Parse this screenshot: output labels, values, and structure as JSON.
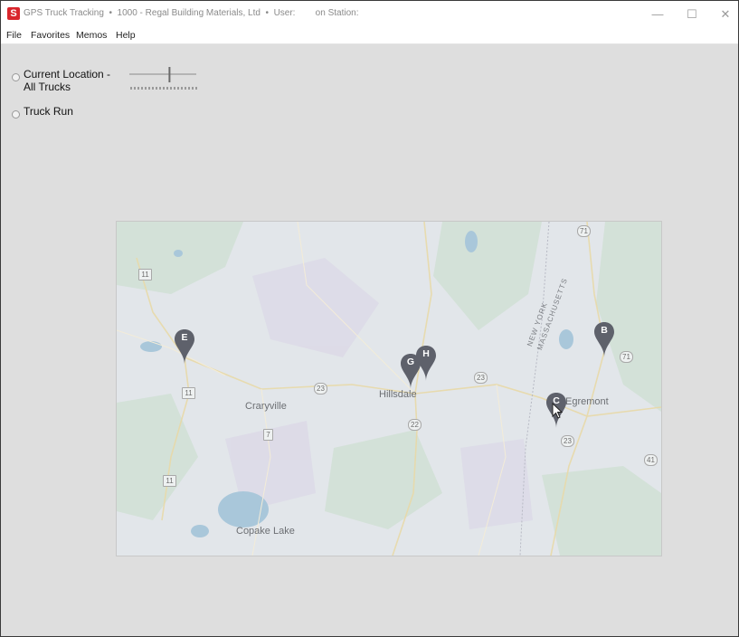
{
  "window": {
    "title": "GPS Truck Tracking  •  1000 - Regal Building Materials, Ltd  •  User:        on Station:",
    "app_icon_letter": "S",
    "minimize": "—",
    "maximize": "☐",
    "close": "✕"
  },
  "menu": {
    "items": [
      "File",
      "Favorites",
      "Memos",
      "Help"
    ]
  },
  "options": {
    "current_location_line1": "Current Location -",
    "current_location_line2": "All Trucks",
    "truck_run": "Truck Run",
    "zoom_slider_level": 0.6
  },
  "map": {
    "places": [
      "Craryville",
      "Hillsdale",
      "Egremont",
      "Copake Lake"
    ],
    "state_border_labels": [
      "NEW YORK",
      "MASSACHUSETTS"
    ],
    "route_shields": [
      "11",
      "11",
      "11",
      "7",
      "23",
      "22",
      "23",
      "23",
      "71",
      "71",
      "41"
    ],
    "markers": [
      "E",
      "G",
      "H",
      "C",
      "B"
    ],
    "colors": {
      "marker": "#5e616b",
      "water": "#a9c7da",
      "park": "#cfe0d3"
    }
  }
}
